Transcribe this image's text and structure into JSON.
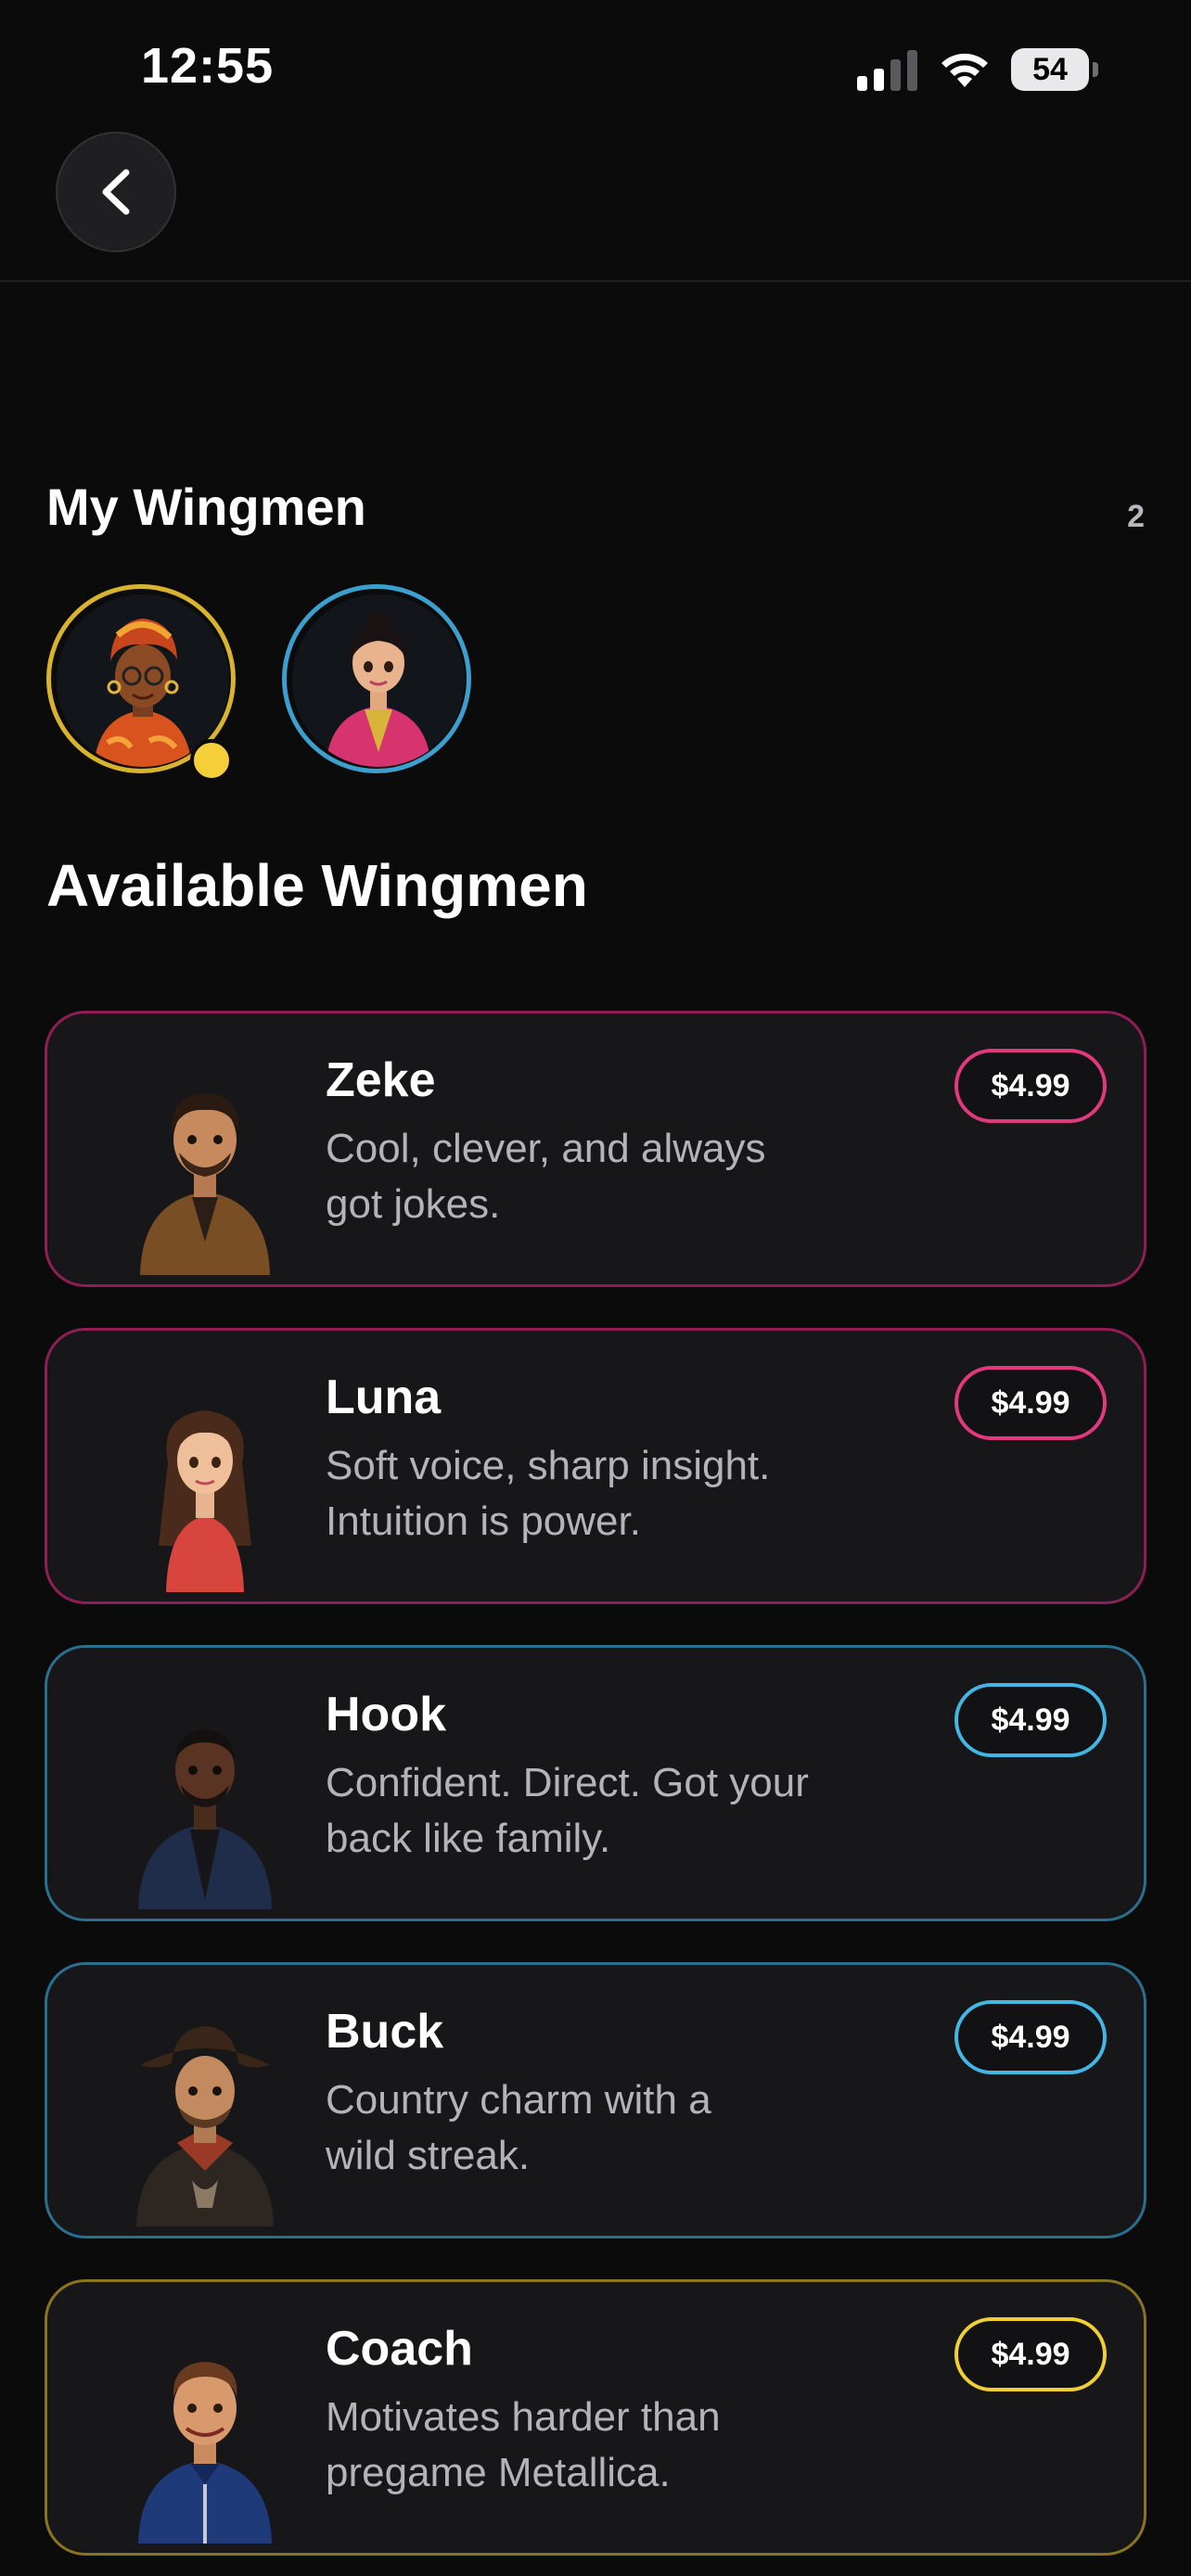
{
  "status_bar": {
    "time": "12:55",
    "battery": "54"
  },
  "my_wingmen": {
    "title": "My Wingmen",
    "count": "2",
    "avatars": [
      {
        "name": "wingman-avatar-1",
        "ring_color": "#d8b32e",
        "online": true
      },
      {
        "name": "wingman-avatar-2",
        "ring_color": "#3c9fce",
        "online": false
      }
    ]
  },
  "available": {
    "title": "Available Wingmen",
    "cards": [
      {
        "name": "Zeke",
        "desc_line1": "Cool, clever, and always",
        "desc_line2": "got jokes.",
        "price": "$4.99",
        "border": "#8f1d56",
        "pill": "#e2397e"
      },
      {
        "name": "Luna",
        "desc_line1": "Soft voice, sharp insight.",
        "desc_line2": "Intuition is power.",
        "price": "$4.99",
        "border": "#8f1d56",
        "pill": "#e2397e"
      },
      {
        "name": "Hook",
        "desc_line1": "Confident. Direct. Got your",
        "desc_line2": "back like family.",
        "price": "$4.99",
        "border": "#2a6f8e",
        "pill": "#44b6e3"
      },
      {
        "name": "Buck",
        "desc_line1": "Country charm with a",
        "desc_line2": "wild streak.",
        "price": "$4.99",
        "border": "#2a6f8e",
        "pill": "#44b6e3"
      },
      {
        "name": "Coach",
        "desc_line1": "Motivates harder than",
        "desc_line2": "pregame Metallica.",
        "price": "$4.99",
        "border": "#8a7420",
        "pill": "#f0cf35"
      }
    ]
  }
}
